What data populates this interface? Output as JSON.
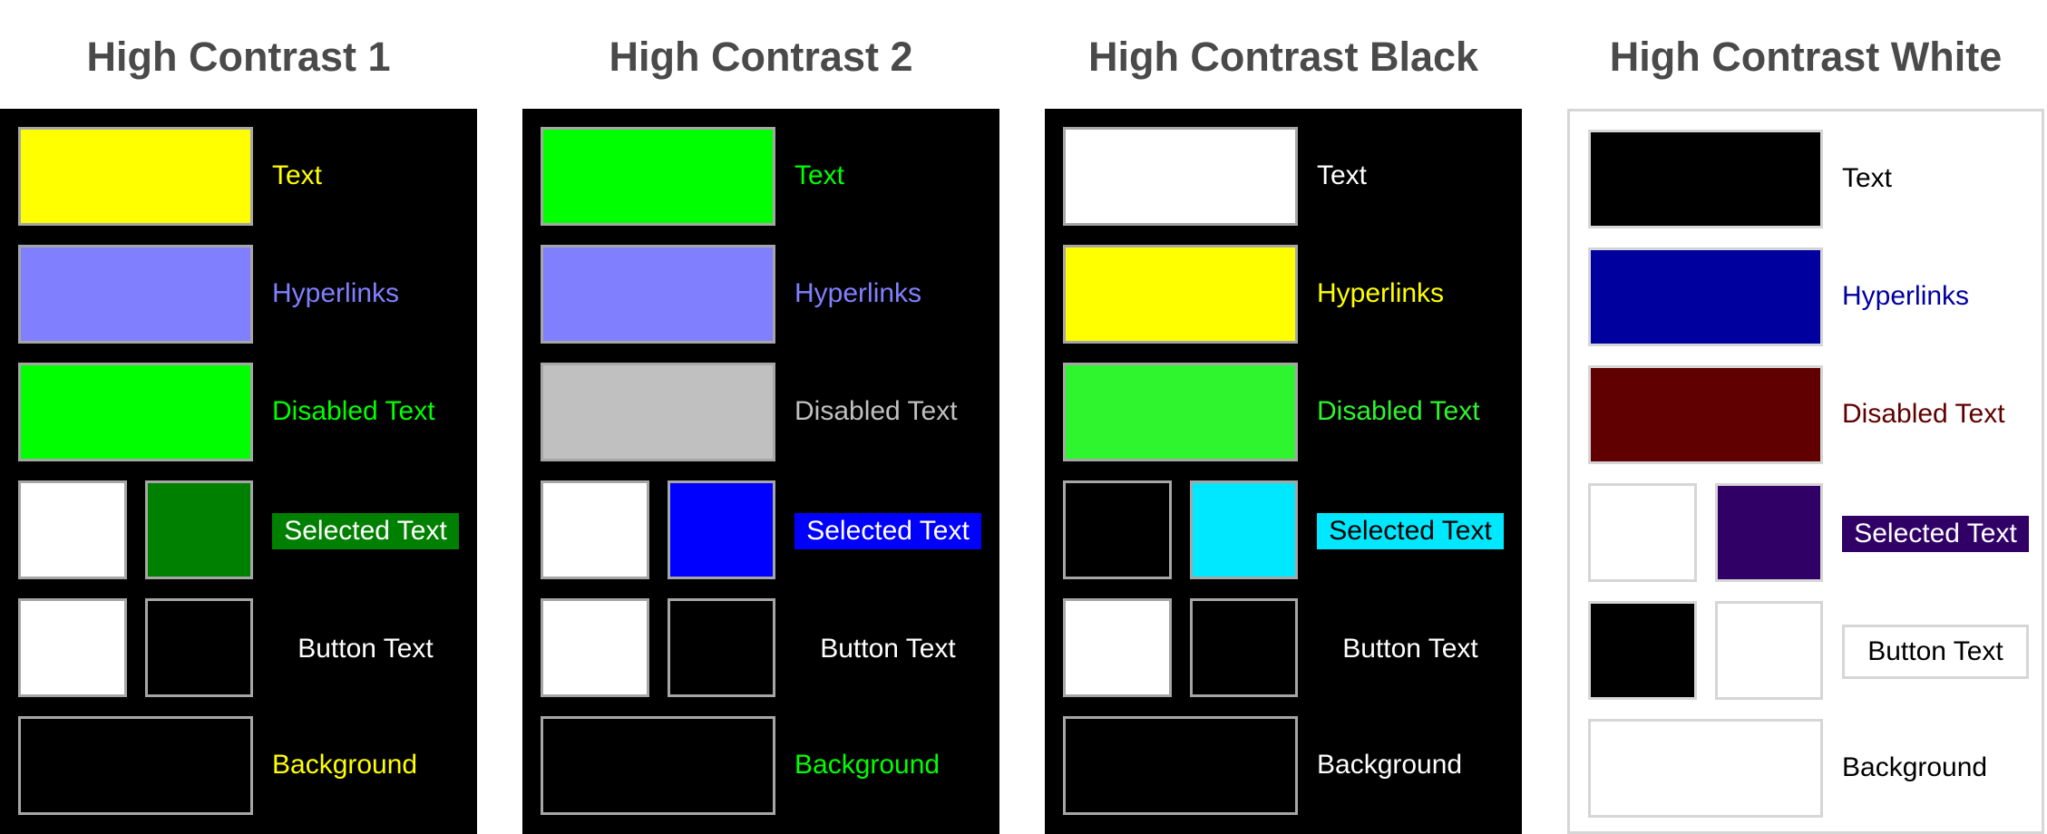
{
  "themes": [
    {
      "title": "High Contrast 1",
      "panel_bg": "#000000",
      "panel_border": "none",
      "text_label": "Text",
      "text_color": "#ffff00",
      "hyperlinks_label": "Hyperlinks",
      "hyperlinks_color": "#8080ff",
      "disabled_label": "Disabled Text",
      "disabled_color": "#00ff00",
      "selected_label": "Selected Text",
      "selected_fg": "#ffffff",
      "selected_bg": "#008000",
      "button_label": "Button Text",
      "button_fg": "#ffffff",
      "button_bg": "#000000",
      "button_border": "#000000",
      "background_label": "Background",
      "background_color": "#000000",
      "background_label_color": "#ffff00"
    },
    {
      "title": "High Contrast 2",
      "panel_bg": "#000000",
      "panel_border": "none",
      "text_label": "Text",
      "text_color": "#00ff00",
      "hyperlinks_label": "Hyperlinks",
      "hyperlinks_color": "#8080ff",
      "disabled_label": "Disabled Text",
      "disabled_color": "#c0c0c0",
      "selected_label": "Selected Text",
      "selected_fg": "#ffffff",
      "selected_bg": "#0000ff",
      "button_label": "Button Text",
      "button_fg": "#ffffff",
      "button_bg": "#000000",
      "button_border": "#000000",
      "background_label": "Background",
      "background_color": "#000000",
      "background_label_color": "#00ff00"
    },
    {
      "title": "High Contrast Black",
      "panel_bg": "#000000",
      "panel_border": "none",
      "text_label": "Text",
      "text_color": "#ffffff",
      "hyperlinks_label": "Hyperlinks",
      "hyperlinks_color": "#ffff00",
      "disabled_label": "Disabled Text",
      "disabled_color": "#2ef52e",
      "selected_label": "Selected Text",
      "selected_fg": "#000000",
      "selected_bg": "#00e8ff",
      "button_label": "Button Text",
      "button_fg": "#ffffff",
      "button_bg": "#000000",
      "button_border": "#000000",
      "background_label": "Background",
      "background_color": "#000000",
      "background_label_color": "#ffffff"
    },
    {
      "title": "High Contrast White",
      "panel_bg": "#ffffff",
      "panel_border": "#d6d6d6",
      "text_label": "Text",
      "text_color": "#000000",
      "hyperlinks_label": "Hyperlinks",
      "hyperlinks_color": "#00009f",
      "disabled_label": "Disabled Text",
      "disabled_color": "#600000",
      "selected_label": "Selected Text",
      "selected_fg": "#ffffff",
      "selected_bg": "#300066",
      "button_label": "Button Text",
      "button_fg": "#000000",
      "button_bg": "#ffffff",
      "button_border": "#d6d6d6",
      "background_label": "Background",
      "background_color": "#ffffff",
      "background_label_color": "#000000"
    }
  ]
}
